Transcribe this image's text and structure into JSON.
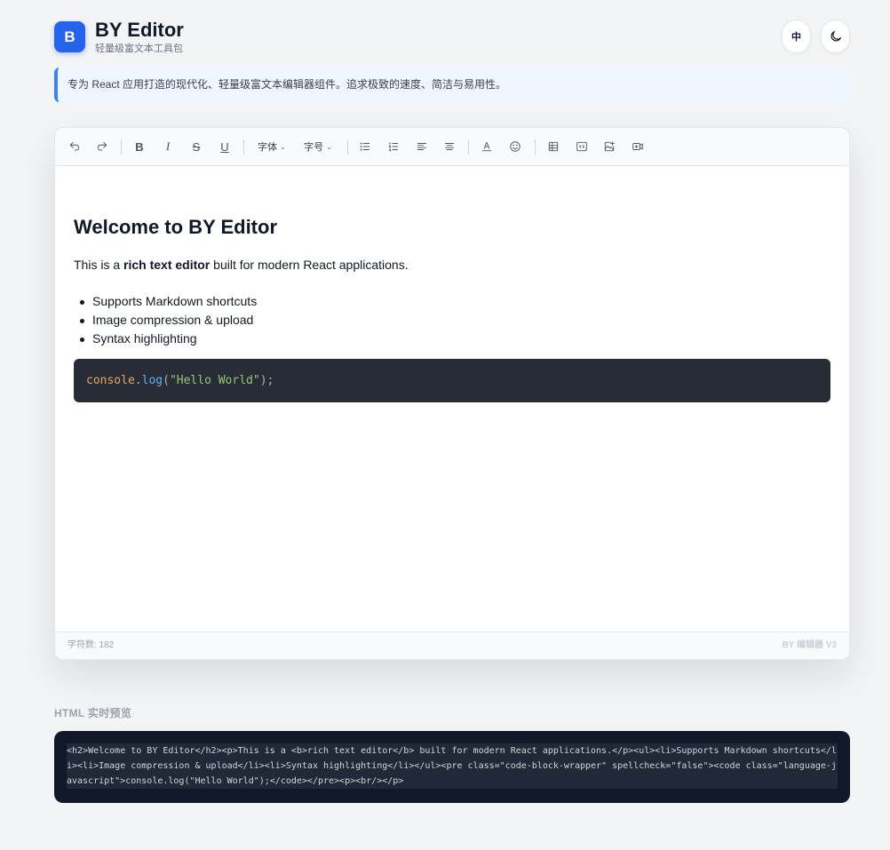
{
  "header": {
    "logo_letter": "B",
    "title": "BY Editor",
    "subtitle": "轻量级富文本工具包",
    "lang_label": "中",
    "theme_icon": "moon-icon"
  },
  "banner": {
    "text": "专为 React 应用打造的现代化、轻量级富文本编辑器组件。追求极致的速度、简洁与易用性。"
  },
  "toolbar": {
    "icons": [
      "undo-icon",
      "redo-icon",
      "bold-icon",
      "italic-icon",
      "strikethrough-icon",
      "underline-icon",
      "bullet-list-icon",
      "numbered-list-icon",
      "align-left-icon",
      "align-center-icon",
      "text-color-icon",
      "emoji-icon",
      "table-icon",
      "code-block-icon",
      "image-icon",
      "video-icon"
    ],
    "font_label": "字体",
    "size_label": "字号",
    "bold_glyph": "B",
    "italic_glyph": "I",
    "strike_glyph": "S",
    "underline_glyph": "U"
  },
  "document": {
    "heading": "Welcome to BY Editor",
    "para_prefix": "This is a ",
    "para_bold": "rich text editor",
    "para_suffix": " built for modern React applications.",
    "list": [
      "Supports Markdown shortcuts",
      "Image compression & upload",
      "Syntax highlighting"
    ],
    "code": {
      "obj": "console",
      "dot": ".",
      "fn": "log",
      "open": "(",
      "str": "\"Hello World\"",
      "close": ");"
    }
  },
  "footer": {
    "char_count": "字符数: 182",
    "version": "BY 编辑器 V3"
  },
  "preview": {
    "label": "HTML 实时预览",
    "html": "<h2>Welcome to BY Editor</h2><p>This is a <b>rich text editor</b> built for modern React applications.</p><ul><li>Supports Markdown shortcuts</li><li>Image compression & upload</li><li>Syntax highlighting</li></ul><pre class=\"code-block-wrapper\" spellcheck=\"false\"><code class=\"language-javascript\">console.log(\"Hello World\");</code></pre><p><br/></p>"
  },
  "colors": {
    "accent": "#2563eb",
    "banner_border": "#3b82f6",
    "code_bg": "#282c34",
    "preview_bg": "#111827"
  }
}
